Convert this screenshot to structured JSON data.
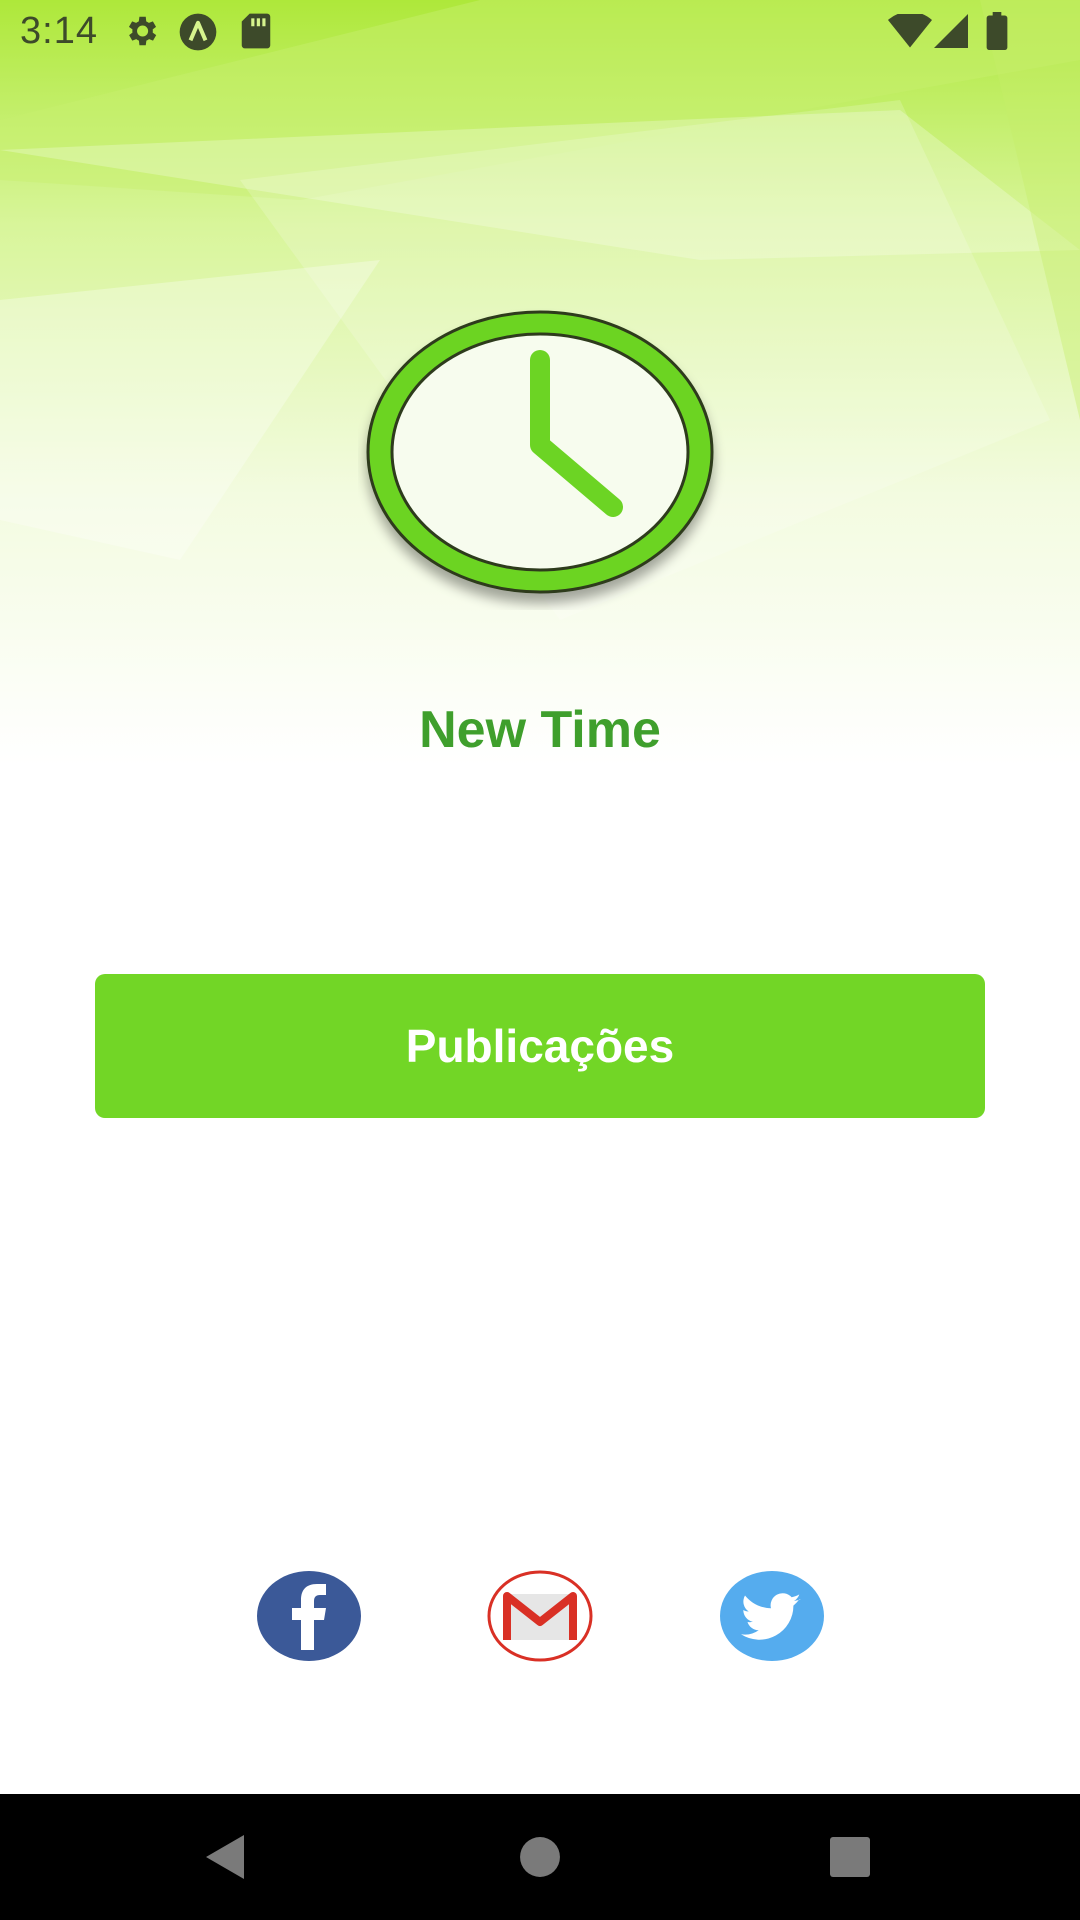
{
  "status_bar": {
    "time": "3:14",
    "left_icons": [
      "gear-icon",
      "app-a-icon",
      "sd-card-icon"
    ],
    "right_icons": [
      "wifi-icon",
      "cell-signal-icon",
      "battery-icon"
    ]
  },
  "app": {
    "logo_icon": "clock-icon",
    "title": "New Time",
    "primary_button_label": "Publicações"
  },
  "social": [
    {
      "name": "facebook-icon",
      "color": "#3b5998"
    },
    {
      "name": "gmail-icon",
      "color": "#d93025"
    },
    {
      "name": "twitter-icon",
      "color": "#55acee"
    }
  ],
  "nav_bar": {
    "buttons": [
      "back-icon",
      "home-icon",
      "recents-icon"
    ]
  },
  "colors": {
    "accent": "#72d626",
    "title": "#3f9f2c",
    "clock_ring": "#6cd424",
    "background_top": "#aee83a"
  }
}
